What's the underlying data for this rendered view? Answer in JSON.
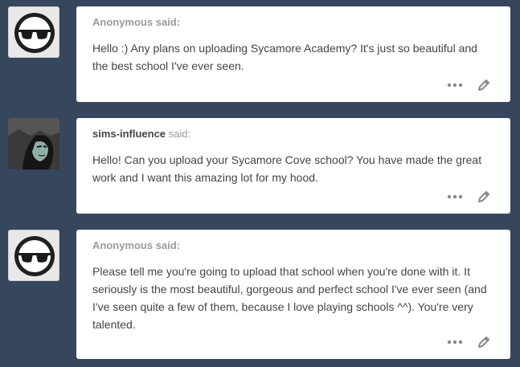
{
  "asks": [
    {
      "asker": "Anonymous",
      "said": "said:",
      "question": "Hello :) Any plans on uploading Sycamore Academy? It's just so beautiful and the best school I've ever seen."
    },
    {
      "asker": "sims-influence",
      "said": "said:",
      "question": "Hello! Can you upload your Sycamore Cove school? You have made the great work and I want this amazing lot for my hood."
    },
    {
      "asker": "Anonymous",
      "said": "said:",
      "question": "Please tell me you're going to upload that school when you're done with it. It seriously is the most beautiful, gorgeous and perfect school I've ever seen (and I've seen quite a few of them, because I love playing schools ^^). You're very talented."
    }
  ],
  "icons": {
    "anon_avatar": "sunglasses-avatar-icon",
    "more": "ellipsis-icon",
    "edit": "pencil-icon"
  },
  "colors": {
    "background": "#36465d",
    "card": "#ffffff",
    "text": "#444444",
    "muted": "#9a9a9a"
  }
}
